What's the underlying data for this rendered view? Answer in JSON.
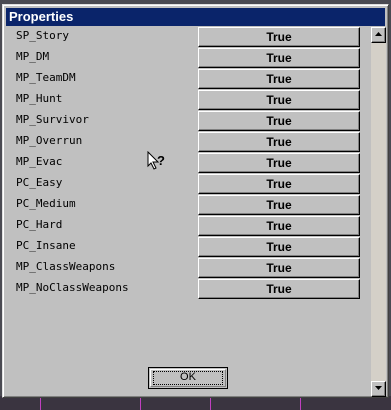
{
  "dialog": {
    "title": "Properties",
    "ok_label": "OK"
  },
  "properties": [
    {
      "name": "SP_Story",
      "value": "True"
    },
    {
      "name": "MP_DM",
      "value": "True"
    },
    {
      "name": "MP_TeamDM",
      "value": "True"
    },
    {
      "name": "MP_Hunt",
      "value": "True"
    },
    {
      "name": "MP_Survivor",
      "value": "True"
    },
    {
      "name": "MP_Overrun",
      "value": "True"
    },
    {
      "name": "MP_Evac",
      "value": "True"
    },
    {
      "name": "PC_Easy",
      "value": "True"
    },
    {
      "name": "PC_Medium",
      "value": "True"
    },
    {
      "name": "PC_Hard",
      "value": "True"
    },
    {
      "name": "PC_Insane",
      "value": "True"
    },
    {
      "name": "MP_ClassWeapons",
      "value": "True"
    },
    {
      "name": "MP_NoClassWeapons",
      "value": "True"
    }
  ],
  "icons": {
    "cursor": "help-cursor-icon",
    "scroll_up": "arrow-up-icon",
    "scroll_down": "arrow-down-icon"
  },
  "colors": {
    "titlebar": "#0a246a",
    "face": "#c0c0c0"
  }
}
